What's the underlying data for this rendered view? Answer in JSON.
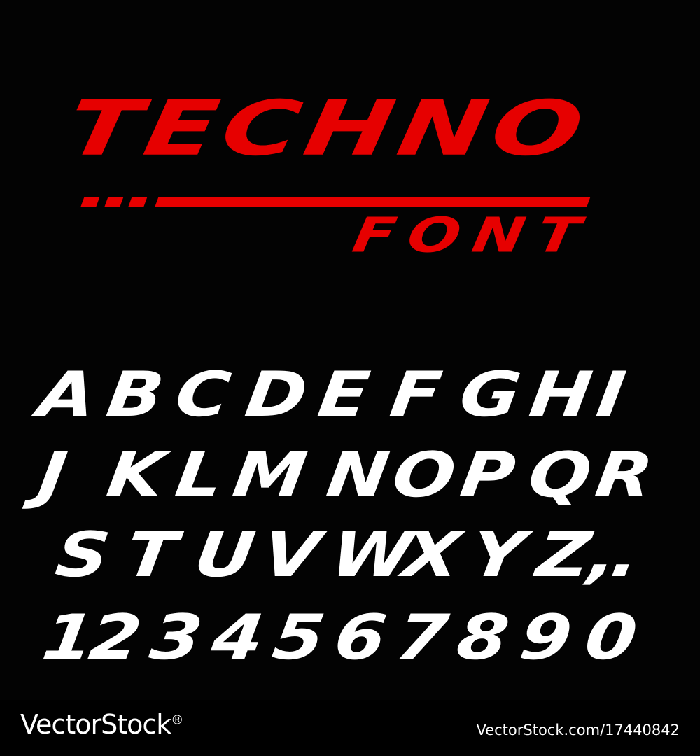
{
  "poster": {
    "title": "TECHNO",
    "subtitle": "FONT",
    "rows": [
      {
        "glyphs": [
          "A",
          "B",
          "C",
          "D",
          "E",
          "F",
          "G",
          "H",
          "I"
        ]
      },
      {
        "glyphs": [
          "J",
          "K",
          "L",
          "M",
          "N",
          "O",
          "P",
          "Q",
          "R"
        ]
      },
      {
        "glyphs": [
          "S",
          "T",
          "U",
          "V",
          "W",
          "X",
          "Y",
          "Z",
          ",",
          "."
        ]
      },
      {
        "glyphs": [
          "1",
          "2",
          "3",
          "4",
          "5",
          "6",
          "7",
          "8",
          "9",
          "0"
        ]
      }
    ]
  },
  "watermark": {
    "brand": "VectorStock",
    "registered": "®",
    "id": "VectorStock.com/17440842"
  },
  "colors": {
    "background": "#030303",
    "accent": "#e60000",
    "glyph": "#ffffff",
    "footer_text": "#ffffff"
  }
}
